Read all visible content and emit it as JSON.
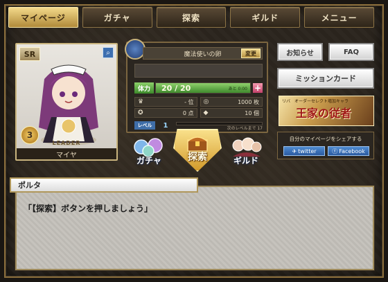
{
  "nav": {
    "items": [
      {
        "label": "マイページ",
        "active": true
      },
      {
        "label": "ガチャ",
        "active": false
      },
      {
        "label": "探索",
        "active": false
      },
      {
        "label": "ギルド",
        "active": false
      },
      {
        "label": "メニュー",
        "active": false
      }
    ]
  },
  "character": {
    "rarity": "SR",
    "stars": "3",
    "leader_label": "LEADER",
    "name": "マイヤ"
  },
  "status": {
    "title": "魔法使いの卵",
    "change_label": "変更",
    "stamina_label": "体力",
    "stamina_text": "20 / 20",
    "stamina_ratio": 1.0,
    "stamina_next": "あと 0:00",
    "rank": "- 位",
    "gold": "1000 枚",
    "points": "0 点",
    "items": "10 個",
    "level_label": "レベル",
    "level": "1",
    "exp_ratio": 0.0,
    "exp_text": "次のレベルまで 17"
  },
  "menu": {
    "gacha": "ガチャ",
    "tansaku": "探索",
    "guild": "ギルド"
  },
  "right": {
    "notice": "お知らせ",
    "faq": "FAQ",
    "mission": "ミッションカード",
    "banner_top": "リバ　オーダーセレクト増加キャラ",
    "banner_title": "王家の従者",
    "share_text": "自分のマイページをシェアする",
    "twitter": "twitter",
    "facebook": "Facebook"
  },
  "dialog": {
    "speaker": "ポルタ",
    "text": "「【探索】ボタンを押しましょう」"
  },
  "colors": {
    "frame": "#8a6d3b",
    "nav_active": "#f3d98a",
    "stamina": "#8fd06c",
    "accent_blue": "#3f6ea8"
  }
}
